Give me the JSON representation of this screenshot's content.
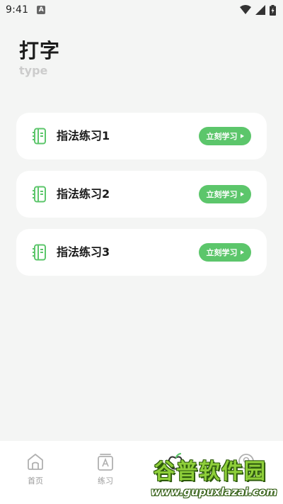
{
  "status_bar": {
    "time": "9:41",
    "notification_icon": "a-badge-icon",
    "indicators": [
      "wifi-icon",
      "signal-icon",
      "battery-charging-icon"
    ]
  },
  "header": {
    "title": "打字",
    "subtitle": "type"
  },
  "lessons": [
    {
      "label": "指法练习1",
      "button": "立刻学习",
      "icon": "notebook-icon"
    },
    {
      "label": "指法练习2",
      "button": "立刻学习",
      "icon": "notebook-icon"
    },
    {
      "label": "指法练习3",
      "button": "立刻学习",
      "icon": "notebook-icon"
    }
  ],
  "bottom_nav": [
    {
      "label": "首页",
      "icon": "home-icon"
    },
    {
      "label": "练习",
      "icon": "practice-icon"
    },
    {
      "label": "",
      "icon": "apple-icon"
    },
    {
      "label": "",
      "icon": "profile-icon"
    }
  ],
  "watermark": {
    "title": "谷普软件园",
    "url": "www.gupuxlazai.com"
  },
  "colors": {
    "background": "#f4f5f4",
    "accent": "#5cc66b",
    "card": "#ffffff",
    "muted_text": "#9a9a9a"
  }
}
